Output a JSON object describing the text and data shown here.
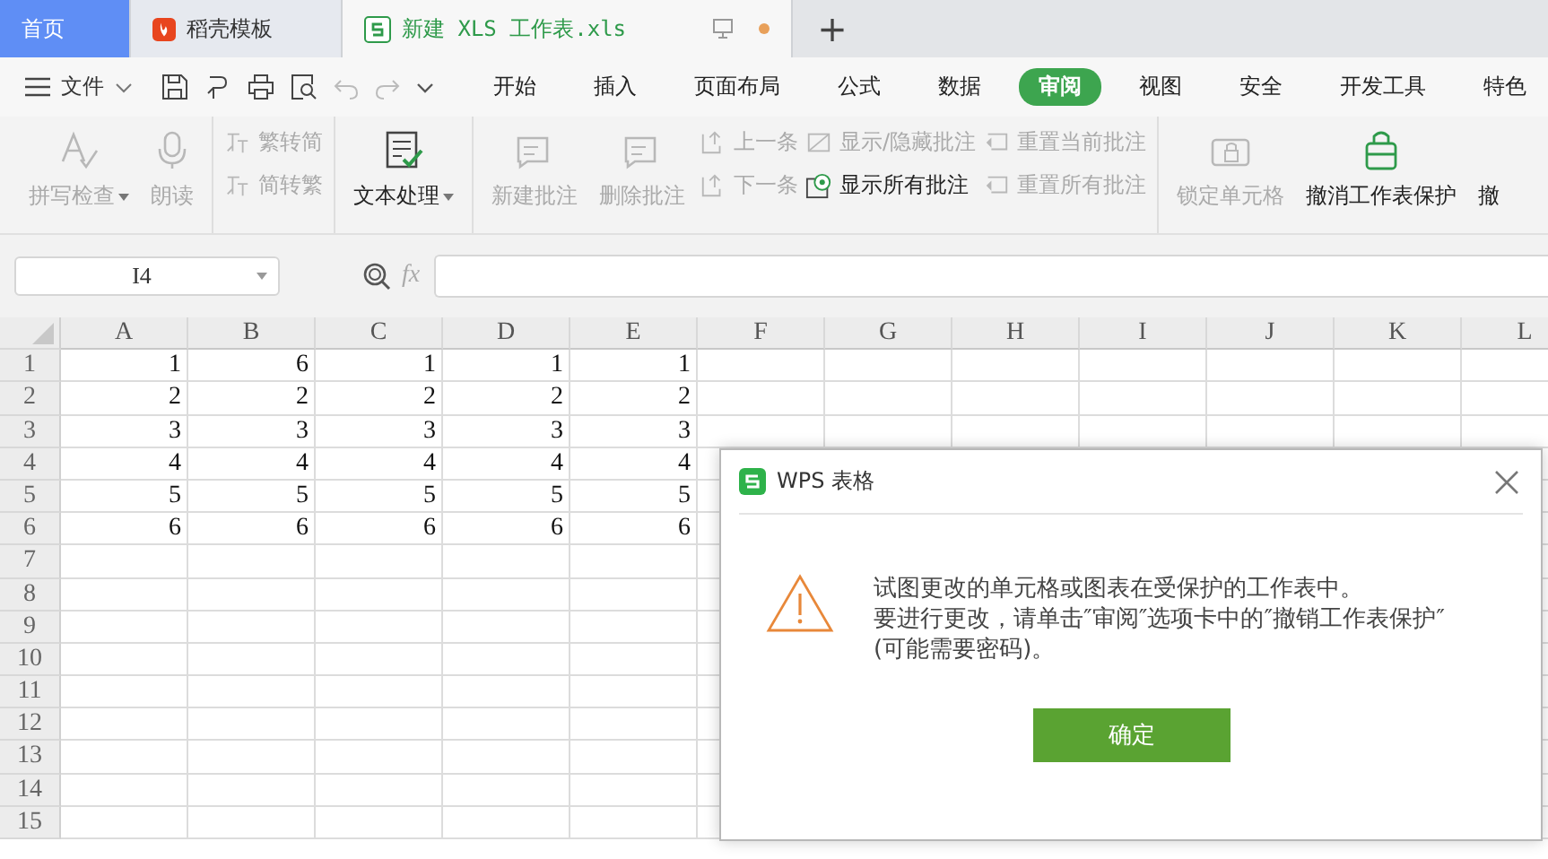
{
  "tabs": [
    {
      "label": "首页",
      "kind": "home",
      "selected": false
    },
    {
      "label": "稻壳模板",
      "kind": "template",
      "selected": false
    },
    {
      "label": "新建 XLS 工作表.xls",
      "kind": "file",
      "selected": true,
      "unsaved": true
    }
  ],
  "new_tab": "+",
  "menu": {
    "file_label": "文件",
    "tabs": [
      {
        "label": "开始",
        "selected": false
      },
      {
        "label": "插入",
        "selected": false
      },
      {
        "label": "页面布局",
        "selected": false
      },
      {
        "label": "公式",
        "selected": false
      },
      {
        "label": "数据",
        "selected": false
      },
      {
        "label": "审阅",
        "selected": true
      },
      {
        "label": "视图",
        "selected": false
      },
      {
        "label": "安全",
        "selected": false
      },
      {
        "label": "开发工具",
        "selected": false
      },
      {
        "label": "特色",
        "selected": false
      }
    ]
  },
  "ribbon": [
    {
      "buttons": [
        {
          "kind": "spell",
          "label": "拼写检查",
          "disabled": true,
          "dropdown": true
        },
        {
          "kind": "mic",
          "label": "朗读",
          "disabled": true,
          "dropdown": false
        }
      ]
    },
    {
      "stacks": [
        [
          {
            "kind": "convert",
            "label": "繁转简",
            "disabled": true
          },
          {
            "kind": "convert",
            "label": "简转繁",
            "disabled": true
          }
        ]
      ]
    },
    {
      "buttons": [
        {
          "kind": "textdoc",
          "label": "文本处理",
          "disabled": false,
          "dropdown": true
        }
      ]
    },
    {
      "buttons": [
        {
          "kind": "comment",
          "label": "新建批注",
          "disabled": true,
          "dropdown": false
        },
        {
          "kind": "comment",
          "label": "删除批注",
          "disabled": true,
          "dropdown": false
        }
      ],
      "stacks": [
        [
          {
            "kind": "up",
            "label": "上一条",
            "disabled": true
          },
          {
            "kind": "down",
            "label": "下一条",
            "disabled": true
          }
        ],
        [
          {
            "kind": "toggle",
            "label": "显示/隐藏批注",
            "disabled": true
          },
          {
            "kind": "eye",
            "label": "显示所有批注",
            "disabled": false
          }
        ],
        [
          {
            "kind": "reset",
            "label": "重置当前批注",
            "disabled": true
          },
          {
            "kind": "reset",
            "label": "重置所有批注",
            "disabled": true
          }
        ]
      ]
    },
    {
      "buttons": [
        {
          "kind": "lock",
          "label": "锁定单元格",
          "disabled": true,
          "dropdown": false
        },
        {
          "kind": "unprotect",
          "label": "撤消工作表保护",
          "disabled": false,
          "dropdown": false
        },
        {
          "kind": "plain",
          "label": "撤",
          "disabled": false,
          "dropdown": false
        }
      ]
    }
  ],
  "name_box": "I4",
  "fx": "fx",
  "sheet": {
    "columns": [
      "A",
      "B",
      "C",
      "D",
      "E",
      "F",
      "G",
      "H",
      "I",
      "J",
      "K",
      "L"
    ],
    "rows": [
      {
        "header": "1",
        "cells": [
          "1",
          "6",
          "1",
          "1",
          "1"
        ]
      },
      {
        "header": "2",
        "cells": [
          "2",
          "2",
          "2",
          "2",
          "2"
        ]
      },
      {
        "header": "3",
        "cells": [
          "3",
          "3",
          "3",
          "3",
          "3"
        ]
      },
      {
        "header": "4",
        "cells": [
          "4",
          "4",
          "4",
          "4",
          "4"
        ]
      },
      {
        "header": "5",
        "cells": [
          "5",
          "5",
          "5",
          "5",
          "5"
        ]
      },
      {
        "header": "6",
        "cells": [
          "6",
          "6",
          "6",
          "6",
          "6"
        ]
      },
      {
        "header": "7",
        "cells": []
      },
      {
        "header": "8",
        "cells": []
      },
      {
        "header": "9",
        "cells": []
      },
      {
        "header": "10",
        "cells": []
      },
      {
        "header": "11",
        "cells": []
      },
      {
        "header": "12",
        "cells": []
      },
      {
        "header": "13",
        "cells": []
      },
      {
        "header": "14",
        "cells": []
      },
      {
        "header": "15",
        "cells": []
      }
    ]
  },
  "dialog": {
    "title": "WPS 表格",
    "message": [
      "试图更改的单元格或图表在受保护的工作表中。",
      "要进行更改，请单击″审阅″选项卡中的″撤销工作表保护″(可能需要密码)。"
    ],
    "button": "确定"
  }
}
